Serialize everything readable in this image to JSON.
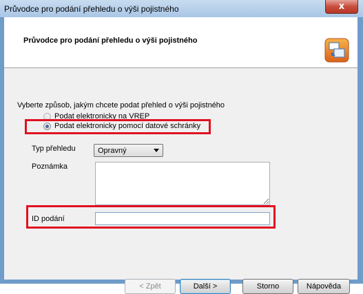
{
  "window": {
    "title": "Průvodce pro  podání přehledu o výši pojistného",
    "close_glyph": "x"
  },
  "header": {
    "title": "Průvodce pro  podání přehledu o výši pojistného",
    "logo_icon": "wizard-logo-icon"
  },
  "form": {
    "prompt": "Vyberte způsob, jakým chcete podat přehled o výši pojistného",
    "radio_options": [
      {
        "label": "Podat elektronicky na VREP",
        "checked": false,
        "enabled": false
      },
      {
        "label": "Podat elektronicky pomocí datové schránky",
        "checked": true,
        "enabled": true
      }
    ],
    "type_label": "Typ přehledu",
    "type_value": "Opravný",
    "note_label": "Poznámka",
    "note_value": "",
    "id_label": "ID podání",
    "id_value": ""
  },
  "buttons": {
    "back": "< Zpět",
    "next": "Další >",
    "cancel": "Storno",
    "help": "Nápověda"
  },
  "colors": {
    "highlight": "#e01020",
    "close_button": "#c84e3e",
    "frame": "#6f9cc9"
  }
}
